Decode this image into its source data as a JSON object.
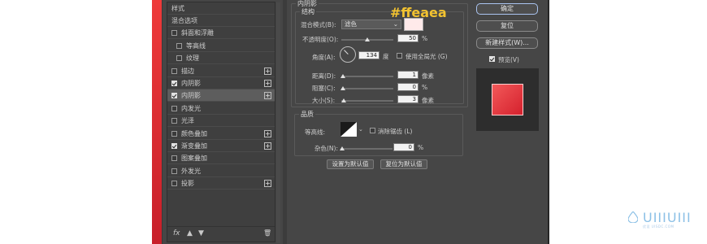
{
  "hex_label": "#ffeaea",
  "style_list": {
    "header": "样式",
    "items": [
      {
        "label": "混合选项",
        "checkbox": false,
        "checked": false,
        "plus": false,
        "active": false,
        "indent": false
      },
      {
        "label": "斜面和浮雕",
        "checkbox": true,
        "checked": false,
        "plus": false,
        "active": false,
        "indent": false
      },
      {
        "label": "等高线",
        "checkbox": true,
        "checked": false,
        "plus": false,
        "active": false,
        "indent": true
      },
      {
        "label": "纹理",
        "checkbox": true,
        "checked": false,
        "plus": false,
        "active": false,
        "indent": true
      },
      {
        "label": "描边",
        "checkbox": true,
        "checked": false,
        "plus": true,
        "active": false,
        "indent": false
      },
      {
        "label": "内阴影",
        "checkbox": true,
        "checked": true,
        "plus": true,
        "active": false,
        "indent": false
      },
      {
        "label": "内阴影",
        "checkbox": true,
        "checked": true,
        "plus": true,
        "active": true,
        "indent": false
      },
      {
        "label": "内发光",
        "checkbox": true,
        "checked": false,
        "plus": false,
        "active": false,
        "indent": false
      },
      {
        "label": "光泽",
        "checkbox": true,
        "checked": false,
        "plus": false,
        "active": false,
        "indent": false
      },
      {
        "label": "颜色叠加",
        "checkbox": true,
        "checked": false,
        "plus": true,
        "active": false,
        "indent": false
      },
      {
        "label": "渐变叠加",
        "checkbox": true,
        "checked": true,
        "plus": true,
        "active": false,
        "indent": false
      },
      {
        "label": "图案叠加",
        "checkbox": true,
        "checked": false,
        "plus": false,
        "active": false,
        "indent": false
      },
      {
        "label": "外发光",
        "checkbox": true,
        "checked": false,
        "plus": false,
        "active": false,
        "indent": false
      },
      {
        "label": "投影",
        "checkbox": true,
        "checked": false,
        "plus": true,
        "active": false,
        "indent": false
      }
    ],
    "footer": {
      "fx": "fx",
      "up": "▲",
      "down": "▼",
      "trash": "🗑"
    }
  },
  "inner_shadow": {
    "section_title": "内阴影",
    "structure": {
      "legend": "结构",
      "blend_mode_label": "混合模式(B):",
      "blend_mode_value": "滤色",
      "swatch_color": "#ffeaea",
      "opacity_label": "不透明度(O):",
      "opacity_value": "50",
      "opacity_unit": "%",
      "opacity_fraction": 0.5,
      "angle_label": "角度(A):",
      "angle_value": "134",
      "angle_unit": "度",
      "global_light_label": "使用全局光 (G)",
      "distance_label": "距离(D):",
      "distance_value": "1",
      "distance_unit": "像素",
      "choke_label": "阻塞(C):",
      "choke_value": "0",
      "choke_unit": "%",
      "size_label": "大小(S):",
      "size_value": "3",
      "size_unit": "像素"
    },
    "quality": {
      "legend": "品质",
      "contour_label": "等高线:",
      "antialias_label": "消除锯齿 (L)",
      "noise_label": "杂色(N):",
      "noise_value": "0",
      "noise_unit": "%"
    },
    "set_default": "设置为默认值",
    "reset_default": "复位为默认值"
  },
  "right_panel": {
    "ok": "确定",
    "reset": "复位",
    "new_style": "新建样式(W)...",
    "preview_label": "预览(V)"
  },
  "logo": {
    "text": "UIIIUIII",
    "sub": "优设 UISDC.COM"
  },
  "colors": {
    "accent_red": "#e02a34",
    "panel": "#464646",
    "hex_text": "#f2c230"
  }
}
